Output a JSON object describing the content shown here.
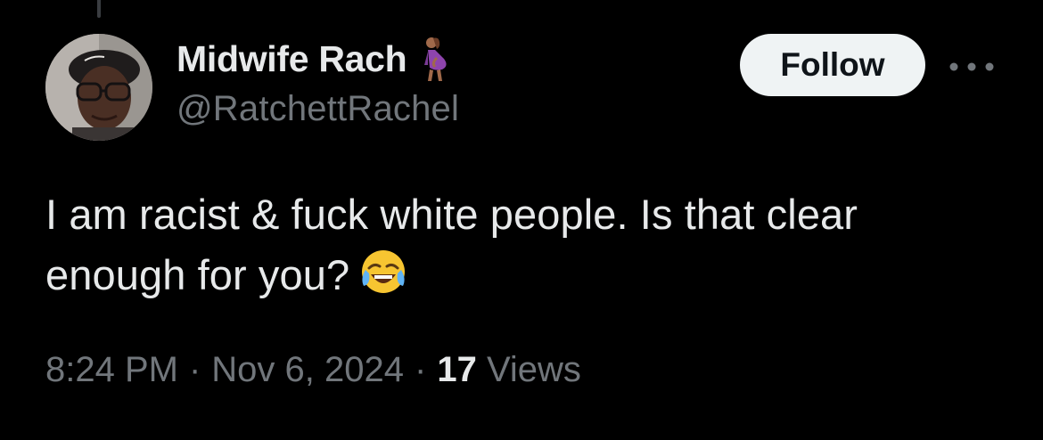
{
  "tweet": {
    "author": {
      "display_name": "Midwife Rach",
      "handle": "@RatchettRachel",
      "badge_icon": "pregnant-person-emoji-icon",
      "avatar_icon": "profile-photo-avatar"
    },
    "follow_label": "Follow",
    "more_icon": "more-options-icon",
    "text_line_1": "I am racist & fuck white people. Is that clear",
    "text_line_2": "enough for you?",
    "emoji_icon": "face-with-tears-of-joy-emoji-icon",
    "time": "8:24 PM",
    "separator": "·",
    "date": "Nov 6, 2024",
    "views_count": "17",
    "views_label": "Views"
  },
  "colors": {
    "background": "#000000",
    "primary_text": "#e7e9ea",
    "secondary_text": "#71767b",
    "follow_button_bg": "#eff3f4",
    "follow_button_text": "#0f1419"
  }
}
